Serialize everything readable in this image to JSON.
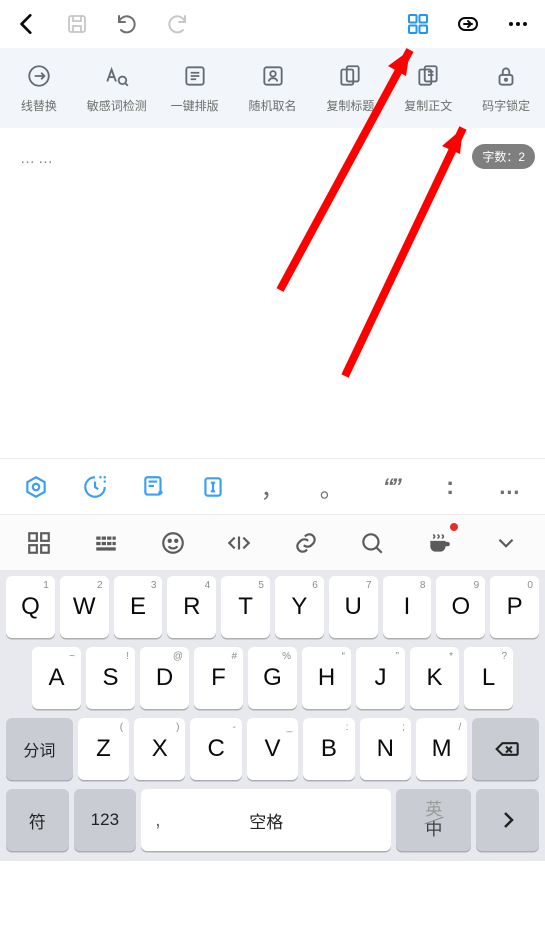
{
  "toolbar": {
    "items": [
      {
        "label": "线替换"
      },
      {
        "label": "敏感词检测"
      },
      {
        "label": "一键排版"
      },
      {
        "label": "随机取名"
      },
      {
        "label": "复制标题"
      },
      {
        "label": "复制正文"
      },
      {
        "label": "码字锁定"
      }
    ]
  },
  "editor": {
    "placeholder": "……",
    "wordcount_label": "字数：2"
  },
  "rowA": {
    "comma": "，",
    "period": "。",
    "ellipsis": "…"
  },
  "keyboard": {
    "row1": [
      {
        "m": "Q",
        "s": "1"
      },
      {
        "m": "W",
        "s": "2"
      },
      {
        "m": "E",
        "s": "3"
      },
      {
        "m": "R",
        "s": "4"
      },
      {
        "m": "T",
        "s": "5"
      },
      {
        "m": "Y",
        "s": "6"
      },
      {
        "m": "U",
        "s": "7"
      },
      {
        "m": "I",
        "s": "8"
      },
      {
        "m": "O",
        "s": "9"
      },
      {
        "m": "P",
        "s": "0"
      }
    ],
    "row2": [
      {
        "m": "A",
        "s": "~"
      },
      {
        "m": "S",
        "s": "!"
      },
      {
        "m": "D",
        "s": "@"
      },
      {
        "m": "F",
        "s": "#"
      },
      {
        "m": "G",
        "s": "%"
      },
      {
        "m": "H",
        "s": "“"
      },
      {
        "m": "J",
        "s": "”"
      },
      {
        "m": "K",
        "s": "*"
      },
      {
        "m": "L",
        "s": "?"
      }
    ],
    "row3": [
      {
        "m": "Z",
        "s": "("
      },
      {
        "m": "X",
        "s": ")"
      },
      {
        "m": "C",
        "s": "-"
      },
      {
        "m": "V",
        "s": "_"
      },
      {
        "m": "B",
        "s": ":"
      },
      {
        "m": "N",
        "s": ";"
      },
      {
        "m": "M",
        "s": "/"
      }
    ],
    "split_label": "分词",
    "symbol_label": "符",
    "num_label": "123",
    "space_label": "空格",
    "lang_top": "英",
    "lang_bottom": "中"
  }
}
